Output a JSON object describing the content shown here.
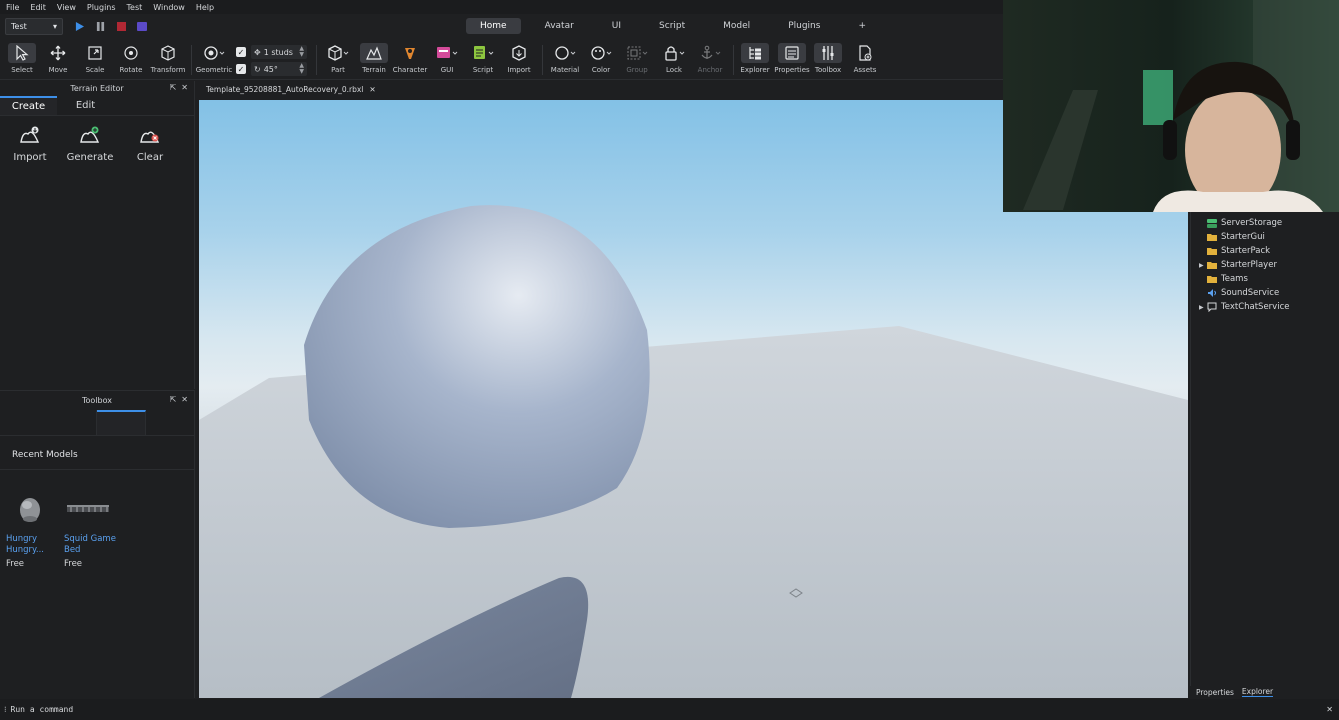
{
  "menu": [
    "File",
    "Edit",
    "View",
    "Plugins",
    "Test",
    "Window",
    "Help"
  ],
  "mode_select": {
    "value": "Test"
  },
  "tabs": [
    {
      "label": "Home",
      "active": true
    },
    {
      "label": "Avatar"
    },
    {
      "label": "UI"
    },
    {
      "label": "Script"
    },
    {
      "label": "Model"
    },
    {
      "label": "Plugins"
    },
    {
      "label": "+"
    }
  ],
  "ribbon": {
    "select": "Select",
    "move": "Move",
    "scale": "Scale",
    "rotate": "Rotate",
    "transform": "Transform",
    "geometric": "Geometric",
    "snap_move": "1 studs",
    "snap_rotate": "45°",
    "part": "Part",
    "terrain": "Terrain",
    "character": "Character",
    "gui": "GUI",
    "script": "Script",
    "import": "Import",
    "material": "Material",
    "color": "Color",
    "group": "Group",
    "lock": "Lock",
    "anchor": "Anchor",
    "explorer": "Explorer",
    "properties": "Properties",
    "toolbox": "Toolbox",
    "assets": "Assets"
  },
  "terrain_editor": {
    "title": "Terrain Editor",
    "tabs": [
      "Create",
      "Edit"
    ],
    "actions": [
      "Import",
      "Generate",
      "Clear"
    ]
  },
  "toolbox": {
    "title": "Toolbox",
    "section": "Recent Models",
    "models": [
      {
        "name": "Hungry Hungry...",
        "price": "Free"
      },
      {
        "name": "Squid Game Bed",
        "price": "Free"
      }
    ]
  },
  "document_tab": "Template_95208881_AutoRecovery_0.rbxl",
  "explorer": {
    "items": [
      {
        "label": "ServerStorage",
        "arrow": false,
        "icon": "server-storage-icon",
        "color": "#4bbf73"
      },
      {
        "label": "StarterGui",
        "arrow": false,
        "icon": "folder-icon",
        "color": "#e2b13c"
      },
      {
        "label": "StarterPack",
        "arrow": false,
        "icon": "folder-icon",
        "color": "#e2b13c"
      },
      {
        "label": "StarterPlayer",
        "arrow": true,
        "icon": "folder-icon",
        "color": "#e2b13c"
      },
      {
        "label": "Teams",
        "arrow": false,
        "icon": "folder-icon",
        "color": "#e2b13c"
      },
      {
        "label": "SoundService",
        "arrow": false,
        "icon": "sound-icon",
        "color": "#5aa0ef"
      },
      {
        "label": "TextChatService",
        "arrow": true,
        "icon": "chat-icon",
        "color": "#d6d8db"
      }
    ]
  },
  "bottom_tabs": [
    "Properties",
    "Explorer"
  ],
  "command_bar": {
    "placeholder": "Run a command"
  },
  "colors": {
    "accent": "#3d8fe8",
    "panel": "#1e1f21",
    "sky_top": "#83c1e6",
    "baseplate": "#c4cbd2"
  }
}
